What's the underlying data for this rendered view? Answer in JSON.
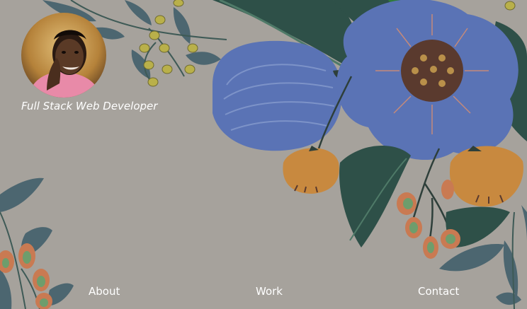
{
  "profile": {
    "tagline": "Full Stack Web Developer"
  },
  "nav": {
    "about": "About",
    "work": "Work",
    "contact": "Contact"
  },
  "colors": {
    "background": "#a6a29c",
    "leaf_dark": "#2e5048",
    "leaf_slate": "#4c6670",
    "flower_blue": "#5a73b5",
    "flower_center": "#5a3a2e",
    "bud_orange": "#c8893f",
    "berry_orange": "#c97a52",
    "berry_green": "#6e9d6c",
    "text": "#ffffff"
  },
  "icons": [
    "profile-photo",
    "floral-background"
  ]
}
